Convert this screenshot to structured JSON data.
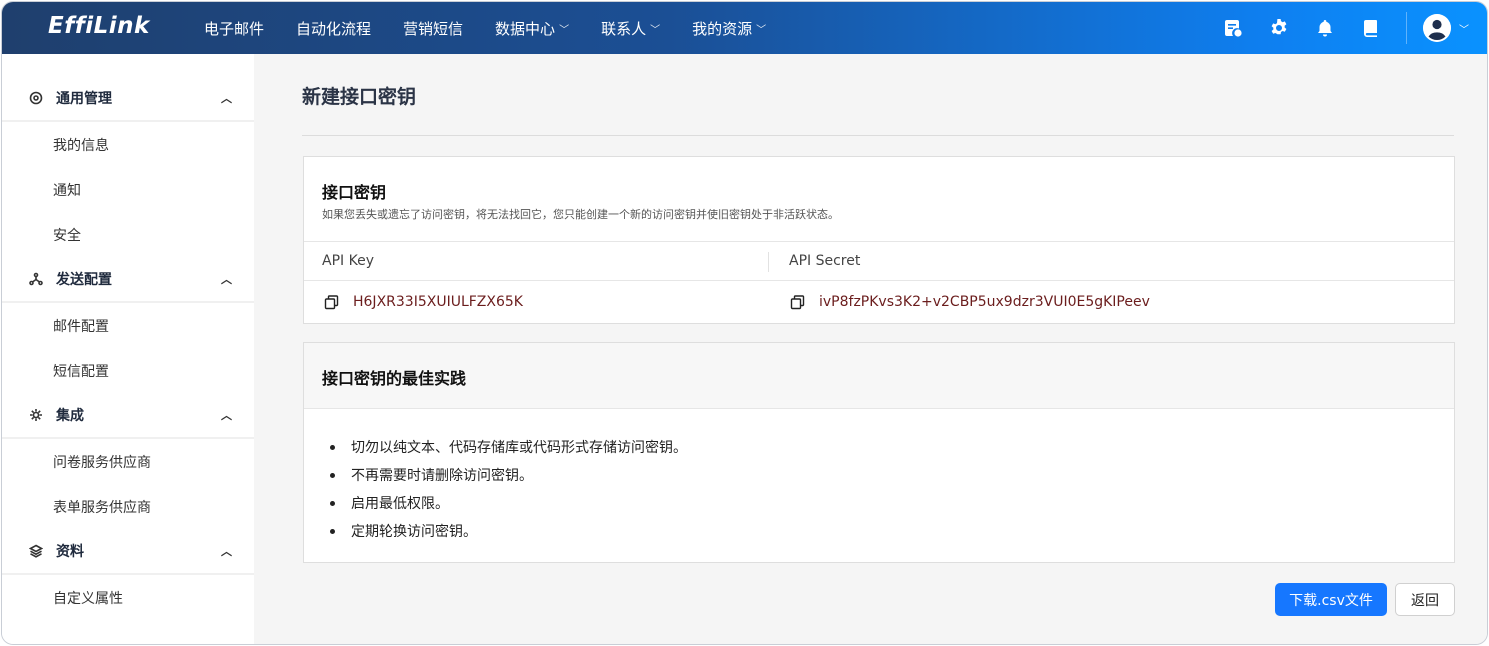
{
  "brand": {
    "logo_text": "EffiLink"
  },
  "topnav": {
    "items": [
      {
        "label": "电子邮件",
        "has_dropdown": false
      },
      {
        "label": "自动化流程",
        "has_dropdown": false
      },
      {
        "label": "营销短信",
        "has_dropdown": false
      },
      {
        "label": "数据中心",
        "has_dropdown": true
      },
      {
        "label": "联系人",
        "has_dropdown": true
      },
      {
        "label": "我的资源",
        "has_dropdown": true
      }
    ],
    "dropdown_glyph": "﹀",
    "icons": [
      "billing-icon",
      "gear-icon",
      "bell-icon",
      "book-icon",
      "user-avatar-icon"
    ],
    "colors": {
      "gradient_start": "#1f3f6d",
      "gradient_end": "#0a92ff"
    }
  },
  "sidebar": {
    "sections": [
      {
        "icon": "target-icon",
        "label": "通用管理",
        "caret": "︿",
        "items": [
          "我的信息",
          "通知",
          "安全"
        ]
      },
      {
        "icon": "share-icon",
        "label": "发送配置",
        "caret": "︿",
        "items": [
          "邮件配置",
          "短信配置"
        ]
      },
      {
        "icon": "integration-icon",
        "label": "集成",
        "caret": "︿",
        "items": [
          "问卷服务供应商",
          "表单服务供应商"
        ]
      },
      {
        "icon": "layers-icon",
        "label": "资料",
        "caret": "︿",
        "items": [
          "自定义属性"
        ]
      }
    ]
  },
  "page": {
    "title": "新建接口密钥",
    "key_card": {
      "title": "接口密钥",
      "subtitle": "如果您丢失或遗忘了访问密钥，将无法找回它，您只能创建一个新的访问密钥并使旧密钥处于非活跃状态。",
      "col_key": "API Key",
      "col_secret": "API Secret",
      "api_key": "H6JXR33I5XUIULFZX65K",
      "api_secret": "ivP8fzPKvs3K2+v2CBP5ux9dzr3VUI0E5gKIPeev"
    },
    "practice_card": {
      "title": "接口密钥的最佳实践",
      "bullets": [
        "切勿以纯文本、代码存储库或代码形式存储访问密钥。",
        "不再需要时请删除访问密钥。",
        "启用最低权限。",
        "定期轮换访问密钥。"
      ]
    },
    "buttons": {
      "download": "下载.csv文件",
      "back": "返回"
    },
    "colors": {
      "primary": "#1677ff",
      "key_text": "#6b1d1d"
    }
  }
}
